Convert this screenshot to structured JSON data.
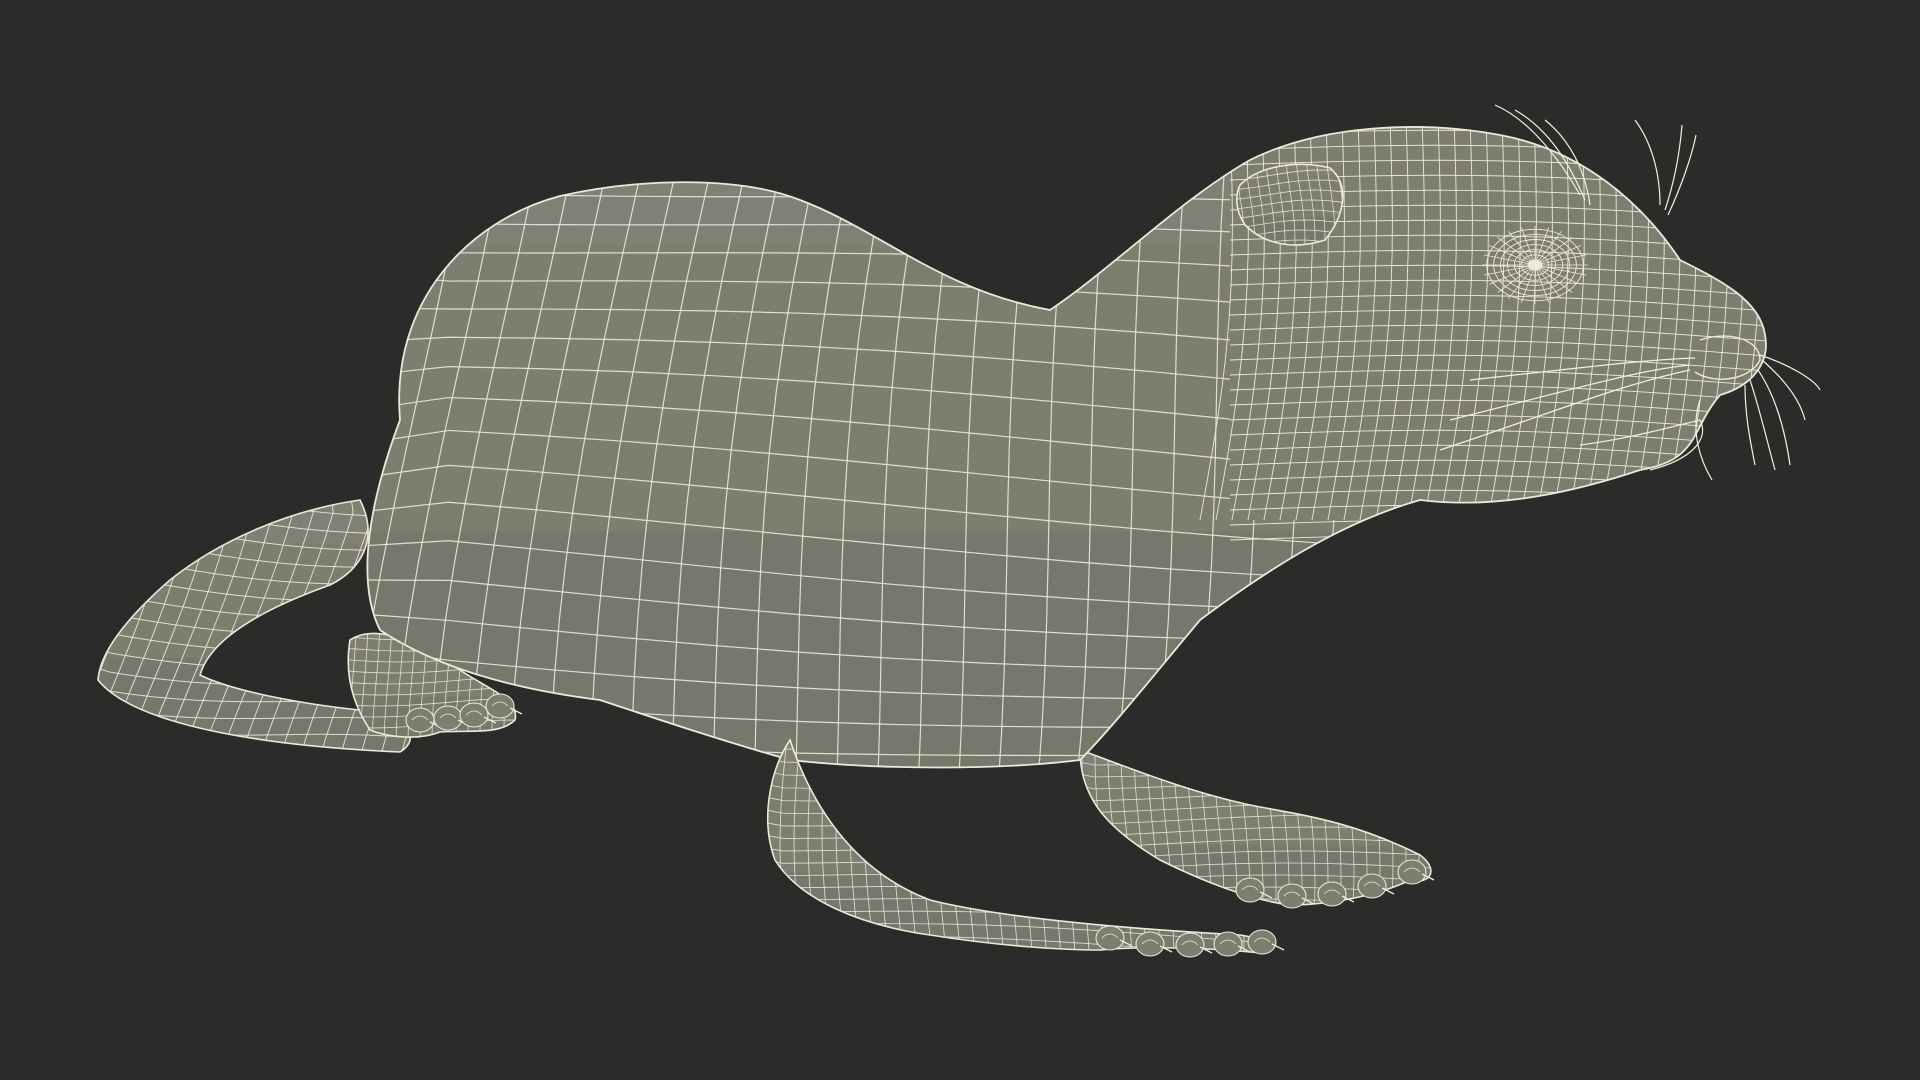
{
  "scene": {
    "subject": "otter-wireframe-model",
    "colors": {
      "background": "#2b2b29",
      "surface": "#7d7e70",
      "surface_shadow": "#6b6c60",
      "surface_highlight": "#8b8c7e",
      "wire": "#ece9d8",
      "whisker": "#f2f0e4"
    }
  }
}
